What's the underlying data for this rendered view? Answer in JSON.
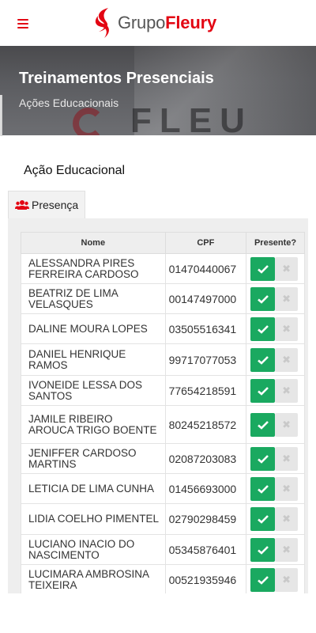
{
  "header": {
    "logo_text_a": "Grupo",
    "logo_text_b": "Fleury"
  },
  "banner": {
    "title": "Treinamentos Presenciais",
    "subtitle": "Ações Educacionais",
    "background_text": "FLEU"
  },
  "section": {
    "title": "Ação Educacional",
    "tab_label": "Presença"
  },
  "table": {
    "columns": [
      "Nome",
      "CPF",
      "Presente?"
    ],
    "rows": [
      {
        "nome": "ALESSANDRA PIRES FERREIRA CARDOSO",
        "cpf": "01470440067"
      },
      {
        "nome": "BEATRIZ DE LIMA VELASQUES",
        "cpf": "00147497000"
      },
      {
        "nome": "DALINE MOURA LOPES",
        "cpf": "03505516341"
      },
      {
        "nome": "DANIEL HENRIQUE RAMOS",
        "cpf": "99717077053"
      },
      {
        "nome": "IVONEIDE LESSA DOS SANTOS",
        "cpf": "77654218591"
      },
      {
        "nome": "JAMILE RIBEIRO AROUCA TRIGO BOENTE",
        "cpf": "80245218572"
      },
      {
        "nome": "JENIFFER CARDOSO MARTINS",
        "cpf": "02087203083"
      },
      {
        "nome": "LETICIA DE LIMA CUNHA",
        "cpf": "01456693000"
      },
      {
        "nome": "LIDIA COELHO PIMENTEL",
        "cpf": "02790298459"
      },
      {
        "nome": "LUCIANO INACIO DO NASCIMENTO",
        "cpf": "05345876401"
      },
      {
        "nome": "LUCIMARA AMBROSINA TEIXEIRA",
        "cpf": "00521935946"
      }
    ]
  },
  "colors": {
    "brand_red": "#e30613",
    "present_green": "#1aa960",
    "absent_gray": "#e6e6e6"
  },
  "icons": {
    "menu": "hamburger-icon",
    "tab": "users-icon",
    "present": "check-icon",
    "absent": "times-icon"
  }
}
